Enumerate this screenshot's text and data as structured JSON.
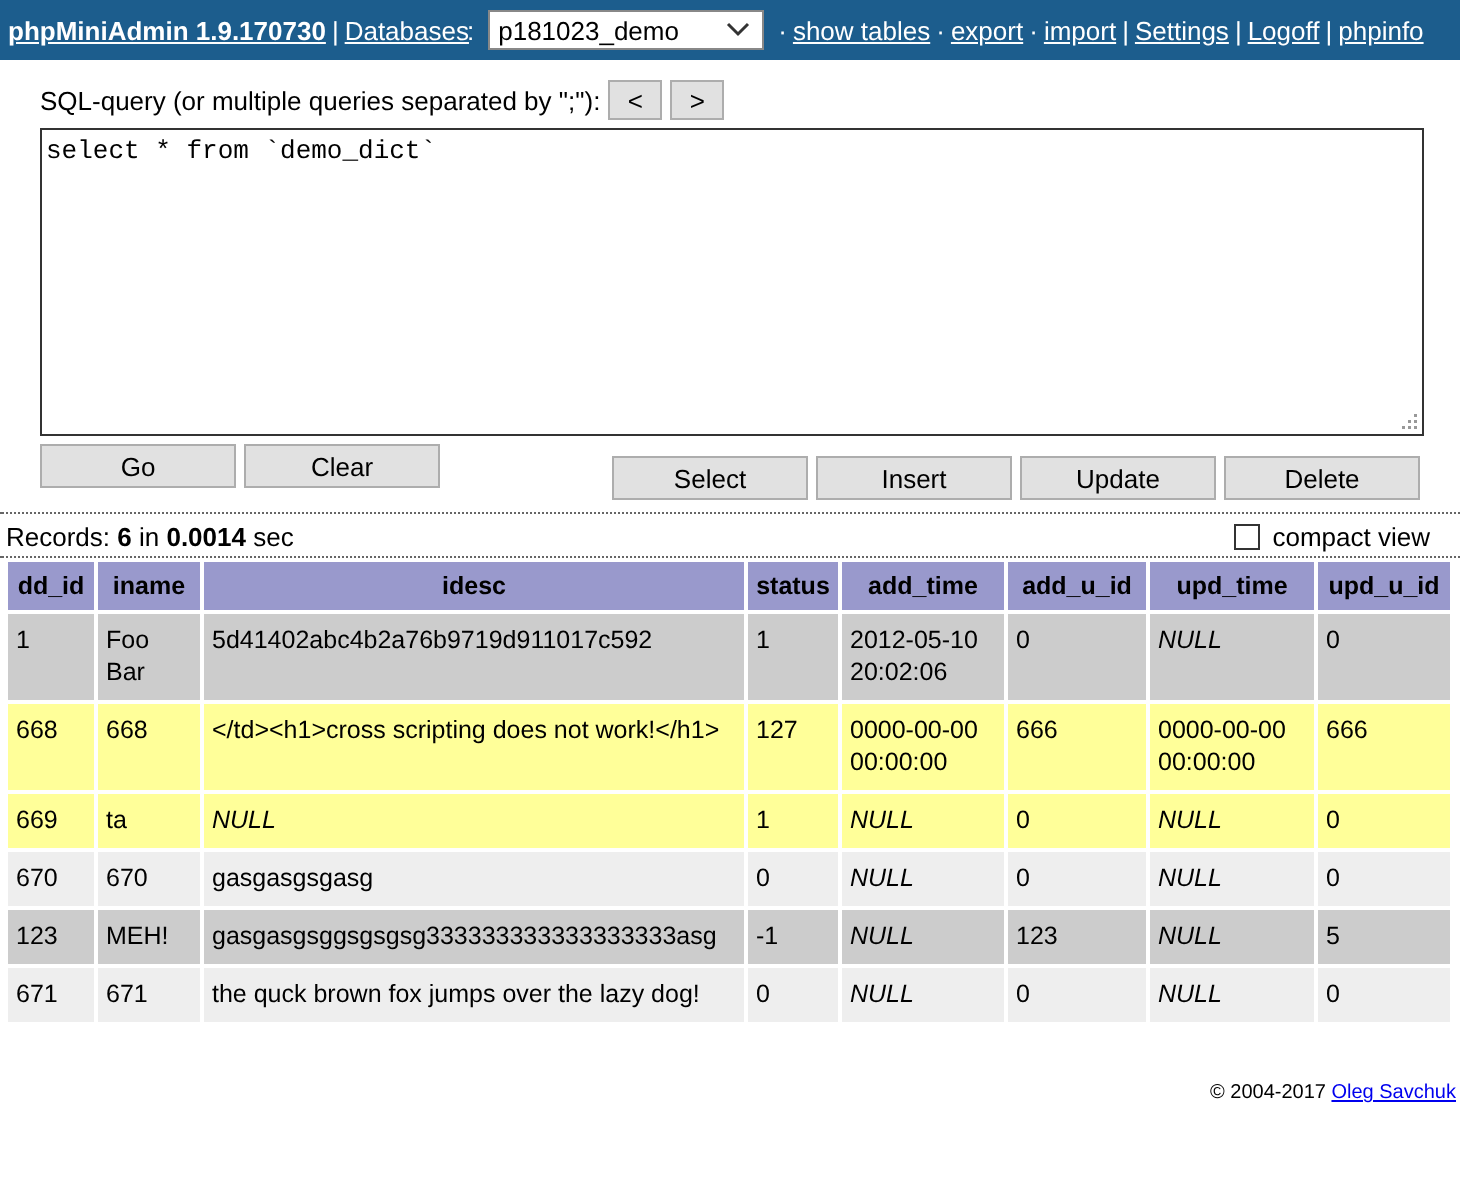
{
  "header": {
    "app_title": "phpMiniAdmin 1.9.170730",
    "title_sep": "|",
    "databases_label": "Databases",
    "colon": ":",
    "database": "p181023_demo",
    "links": [
      {
        "label": "show tables",
        "sep": "·"
      },
      {
        "label": "export",
        "sep": "·"
      },
      {
        "label": "import",
        "sep": "·"
      },
      {
        "label": "Settings",
        "sep": "|"
      },
      {
        "label": "Logoff",
        "sep": "|"
      },
      {
        "label": "phpinfo",
        "sep": "|"
      }
    ]
  },
  "query": {
    "label": "SQL-query (or multiple queries separated by \";\"):",
    "prev": "<",
    "next": ">",
    "value": "select * from `demo_dict`"
  },
  "left_buttons": [
    "Go",
    "Clear"
  ],
  "right_buttons": [
    "Select",
    "Insert",
    "Update",
    "Delete"
  ],
  "records": {
    "prefix": "Records: ",
    "count": "6",
    "mid": " in ",
    "time": "0.0014",
    "suffix": " sec"
  },
  "compact_view": {
    "label": "compact view",
    "checked": false
  },
  "table": {
    "columns": [
      "dd_id",
      "iname",
      "idesc",
      "status",
      "add_time",
      "add_u_id",
      "upd_time",
      "upd_u_id"
    ],
    "rows": [
      {
        "selected": false,
        "cells": [
          {
            "v": "1",
            "null": false
          },
          {
            "v": "Foo Bar",
            "null": false
          },
          {
            "v": "5d41402abc4b2a76b9719d911017c592",
            "null": false
          },
          {
            "v": "1",
            "null": false
          },
          {
            "v": "2012-05-10 20:02:06",
            "null": false
          },
          {
            "v": "0",
            "null": false
          },
          {
            "v": "NULL",
            "null": true
          },
          {
            "v": "0",
            "null": false
          }
        ]
      },
      {
        "selected": true,
        "cells": [
          {
            "v": "668",
            "null": false
          },
          {
            "v": "668",
            "null": false
          },
          {
            "v": "</td><h1>cross scripting does not work!</h1>",
            "null": false
          },
          {
            "v": "127",
            "null": false
          },
          {
            "v": "0000-00-00 00:00:00",
            "null": false
          },
          {
            "v": "666",
            "null": false
          },
          {
            "v": "0000-00-00 00:00:00",
            "null": false
          },
          {
            "v": "666",
            "null": false
          }
        ]
      },
      {
        "selected": true,
        "cells": [
          {
            "v": "669",
            "null": false
          },
          {
            "v": "ta",
            "null": false
          },
          {
            "v": "NULL",
            "null": true
          },
          {
            "v": "1",
            "null": false
          },
          {
            "v": "NULL",
            "null": true
          },
          {
            "v": "0",
            "null": false
          },
          {
            "v": "NULL",
            "null": true
          },
          {
            "v": "0",
            "null": false
          }
        ]
      },
      {
        "selected": false,
        "cells": [
          {
            "v": "670",
            "null": false
          },
          {
            "v": "670",
            "null": false
          },
          {
            "v": "gasgasgsgasg",
            "null": false
          },
          {
            "v": "0",
            "null": false
          },
          {
            "v": "NULL",
            "null": true
          },
          {
            "v": "0",
            "null": false
          },
          {
            "v": "NULL",
            "null": true
          },
          {
            "v": "0",
            "null": false
          }
        ]
      },
      {
        "selected": false,
        "cells": [
          {
            "v": "123",
            "null": false
          },
          {
            "v": "MEH!",
            "null": false
          },
          {
            "v": "gasgasgsggsgsgsg333333333333333333asg",
            "null": false
          },
          {
            "v": "-1",
            "null": false
          },
          {
            "v": "NULL",
            "null": true
          },
          {
            "v": "123",
            "null": false
          },
          {
            "v": "NULL",
            "null": true
          },
          {
            "v": "5",
            "null": false
          }
        ]
      },
      {
        "selected": false,
        "cells": [
          {
            "v": "671",
            "null": false
          },
          {
            "v": "671",
            "null": false
          },
          {
            "v": "the quck brown fox jumps over the lazy dog!",
            "null": false
          },
          {
            "v": "0",
            "null": false
          },
          {
            "v": "NULL",
            "null": true
          },
          {
            "v": "0",
            "null": false
          },
          {
            "v": "NULL",
            "null": true
          },
          {
            "v": "0",
            "null": false
          }
        ]
      }
    ]
  },
  "footer": {
    "copyright": "© 2004-2017",
    "author": "Oleg Savchuk"
  }
}
